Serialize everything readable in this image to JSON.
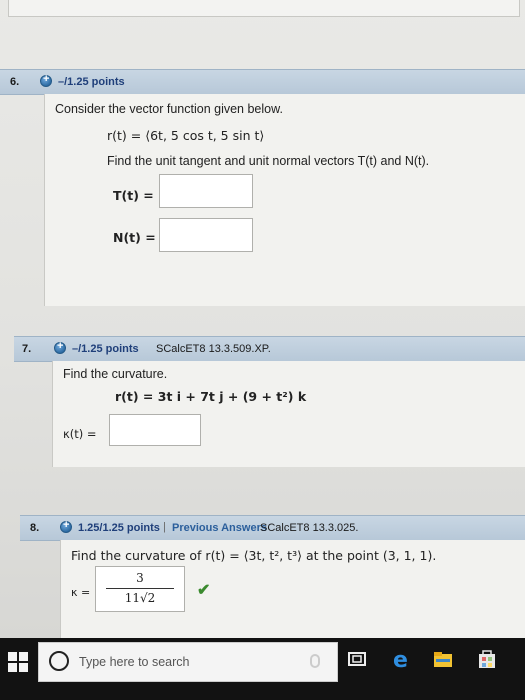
{
  "q6": {
    "number": "6.",
    "points": "–/1.25 points",
    "prompt": "Consider the vector function given below.",
    "function": "r(t) = ⟨6t, 5 cos t, 5 sin t⟩",
    "instruction": "Find the unit tangent and unit normal vectors T(t) and N(t).",
    "t_label": "T(t) =",
    "n_label": "N(t) ="
  },
  "q7": {
    "number": "7.",
    "points": "–/1.25 points",
    "source": "SCalcET8 13.3.509.XP.",
    "prompt": "Find the curvature.",
    "function": "r(t) = 3t i + 7t j + (9 + t²) k",
    "kappa_label": "κ(t) ="
  },
  "q8": {
    "number": "8.",
    "points": "1.25/1.25 points",
    "separator": "|",
    "previous": "Previous Answers",
    "source": "SCalcET8 13.3.025.",
    "prompt": "Find the curvature of r(t) = ⟨3t, t², t³⟩ at the point (3, 1, 1).",
    "kappa_label": "κ =",
    "answer_num": "3",
    "answer_den": "11√2",
    "check": "✔"
  },
  "taskbar": {
    "search_placeholder": "Type here to search"
  }
}
